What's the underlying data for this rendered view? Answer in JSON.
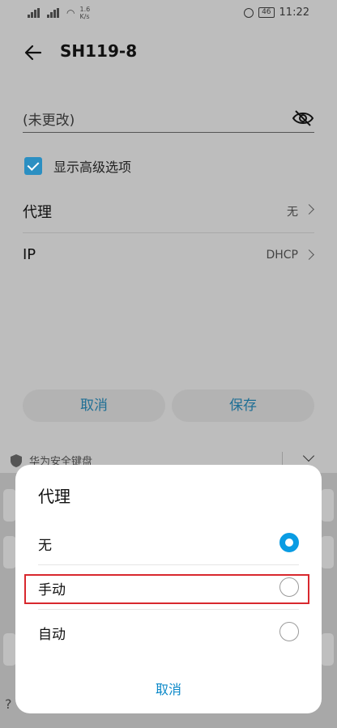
{
  "status_bar": {
    "net_speed_value": "1.6",
    "net_speed_unit": "K/s",
    "battery": "46",
    "time": "11:22"
  },
  "header": {
    "title": "SH119-8"
  },
  "password": {
    "placeholder": "(未更改)"
  },
  "advanced": {
    "label": "显示高级选项",
    "checked": true
  },
  "settings": [
    {
      "label": "代理",
      "value": "无"
    },
    {
      "label": "IP",
      "value": "DHCP"
    }
  ],
  "buttons": {
    "cancel": "取消",
    "save": "保存"
  },
  "keyboard": {
    "title": "华为安全键盘",
    "key_hint": "?"
  },
  "dialog": {
    "title": "代理",
    "options": [
      {
        "label": "无",
        "selected": true
      },
      {
        "label": "手动",
        "selected": false
      },
      {
        "label": "自动",
        "selected": false
      }
    ],
    "cancel": "取消"
  },
  "colors": {
    "accent": "#0a9ce3",
    "highlight": "#d8282e"
  }
}
